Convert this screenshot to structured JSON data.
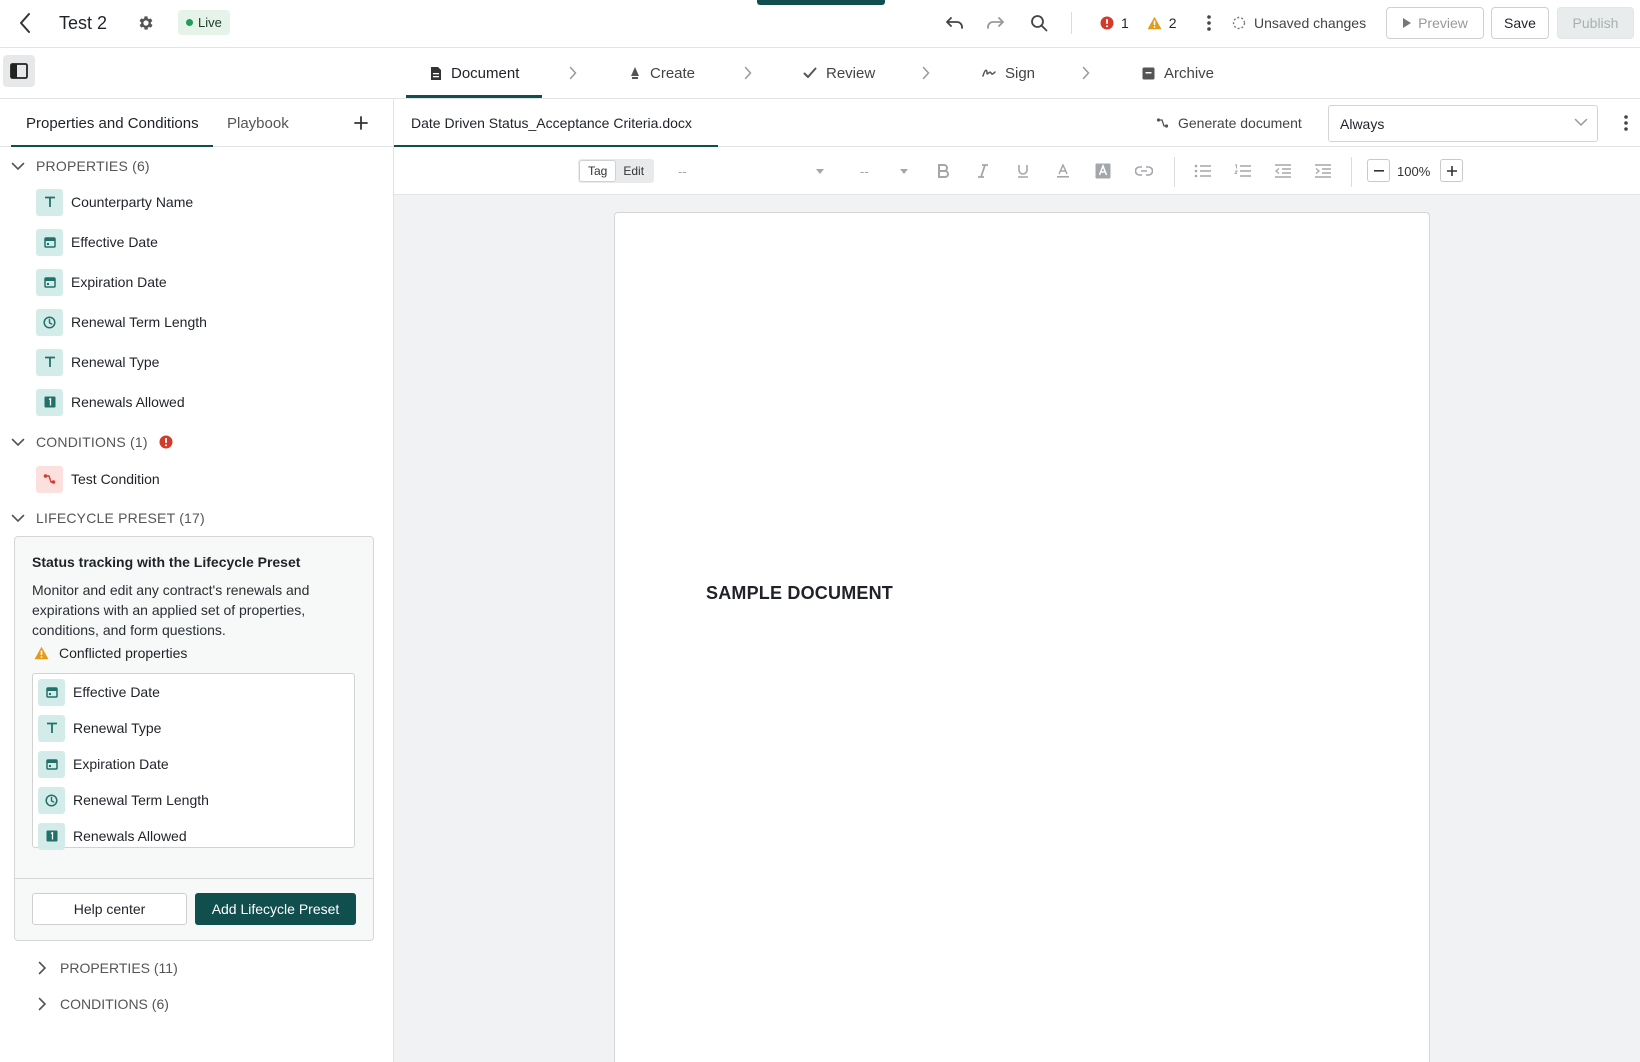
{
  "header": {
    "title": "Test 2",
    "status_badge": "Live",
    "error_count": "1",
    "warning_count": "2",
    "save_status": "Unsaved changes",
    "preview_label": "Preview",
    "save_label": "Save",
    "publish_label": "Publish"
  },
  "steps": [
    {
      "label": "Document",
      "icon": "document-icon",
      "active": true
    },
    {
      "label": "Create",
      "icon": "create-icon"
    },
    {
      "label": "Review",
      "icon": "check-icon"
    },
    {
      "label": "Sign",
      "icon": "signature-icon"
    },
    {
      "label": "Archive",
      "icon": "archive-icon"
    }
  ],
  "left_panel": {
    "tabs": [
      {
        "label": "Properties and Conditions",
        "active": true
      },
      {
        "label": "Playbook"
      }
    ],
    "add_tab_label": "+",
    "properties": {
      "header": "PROPERTIES (6)",
      "items": [
        {
          "label": "Counterparty Name",
          "type": "text-type-icon"
        },
        {
          "label": "Effective Date",
          "type": "calendar-icon"
        },
        {
          "label": "Expiration Date",
          "type": "calendar-icon"
        },
        {
          "label": "Renewal Term Length",
          "type": "clock-icon"
        },
        {
          "label": "Renewal Type",
          "type": "text-type-icon"
        },
        {
          "label": "Renewals Allowed",
          "type": "number-icon"
        }
      ]
    },
    "conditions": {
      "header": "CONDITIONS (1)",
      "items": [
        {
          "label": "Test Condition",
          "type": "condition-icon"
        }
      ]
    },
    "lifecycle": {
      "header": "LIFECYCLE PRESET (17)",
      "card_title": "Status tracking with the Lifecycle Preset",
      "card_description": "Monitor and edit any contract's renewals and expirations with an applied set of properties, conditions, and form questions.",
      "conflict_label": "Conflicted properties",
      "conflicted": [
        {
          "label": "Effective Date",
          "type": "calendar-icon"
        },
        {
          "label": "Renewal Type",
          "type": "text-type-icon"
        },
        {
          "label": "Expiration Date",
          "type": "calendar-icon"
        },
        {
          "label": "Renewal Term Length",
          "type": "clock-icon"
        },
        {
          "label": "Renewals Allowed",
          "type": "number-icon"
        }
      ],
      "help_label": "Help center",
      "add_label": "Add Lifecycle Preset",
      "sub_properties": "PROPERTIES (11)",
      "sub_conditions": "CONDITIONS (6)"
    }
  },
  "main": {
    "doc_tab": "Date Driven Status_Acceptance Criteria.docx",
    "generate_label": "Generate document",
    "condition_select": "Always",
    "toolbar": {
      "mode_tag": "Tag",
      "mode_edit": "Edit",
      "font_family": "--",
      "font_size": "--",
      "zoom": "100%"
    },
    "page_heading": "SAMPLE DOCUMENT"
  },
  "colors": {
    "brand": "#114e4e",
    "live": "#1f9d55",
    "error": "#d23a2c",
    "warning": "#e39b1c"
  }
}
